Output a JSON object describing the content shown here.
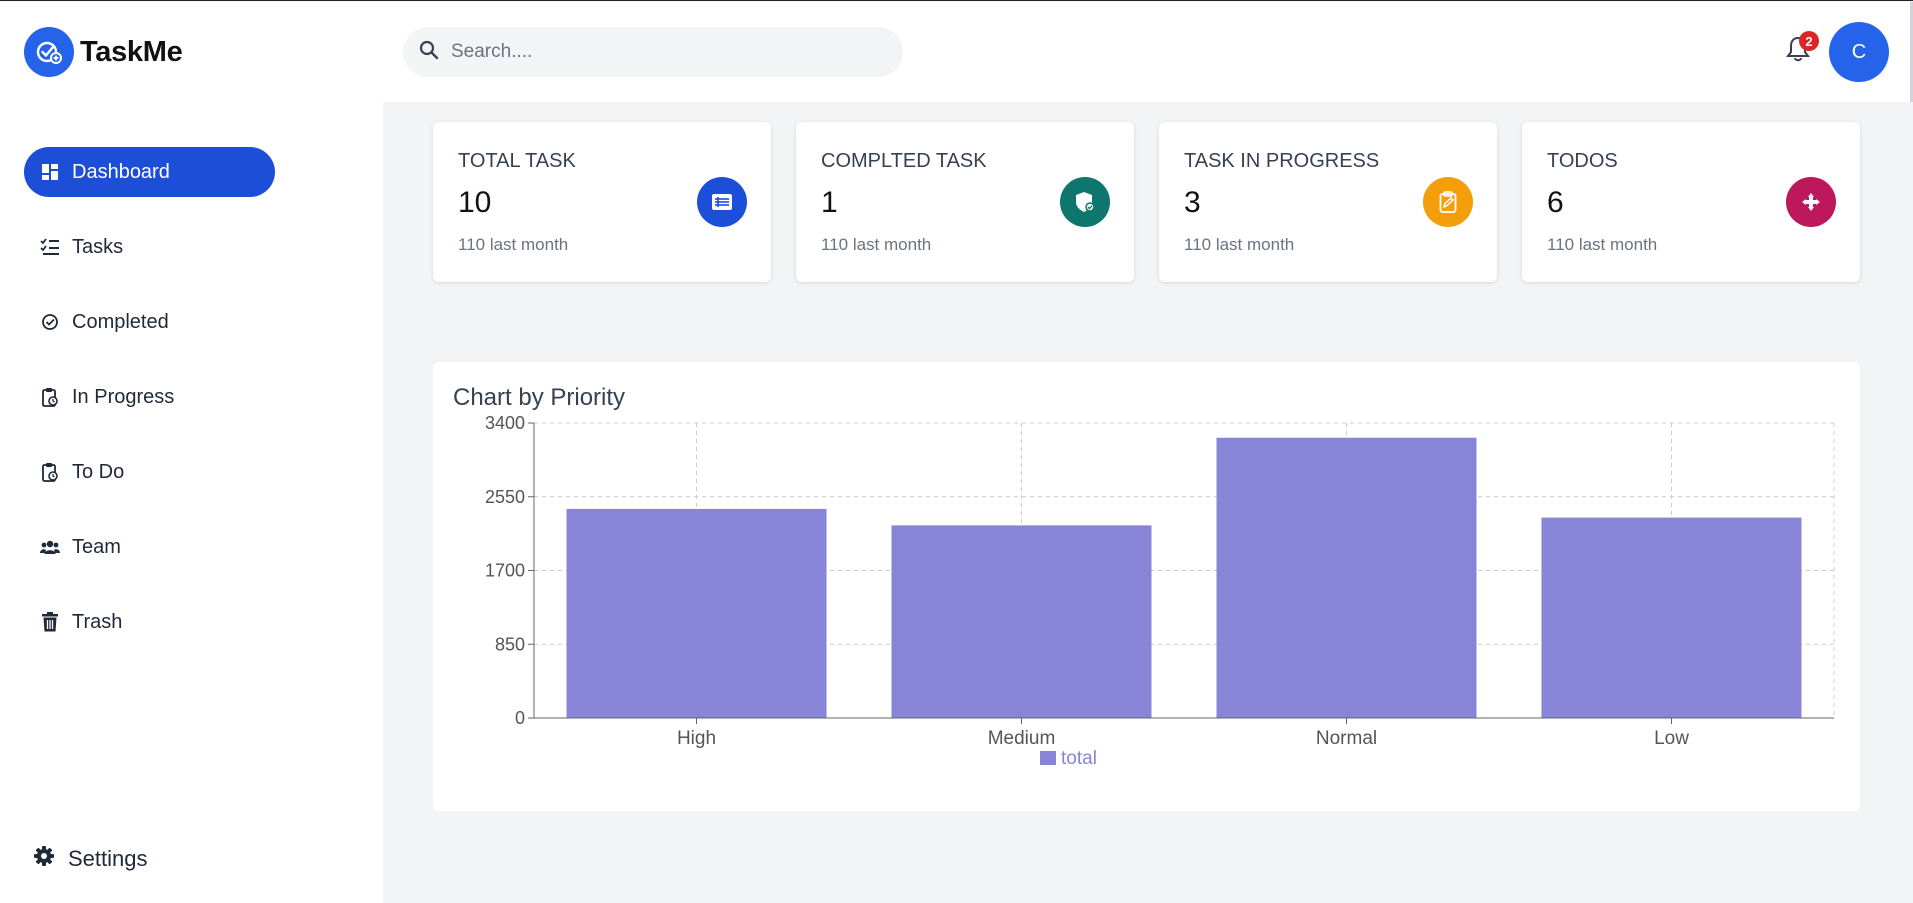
{
  "brand": {
    "name": "TaskMe"
  },
  "sidebar": {
    "items": [
      {
        "label": "Dashboard",
        "icon": "dashboard-icon",
        "active": true
      },
      {
        "label": "Tasks",
        "icon": "checklist-icon",
        "active": false
      },
      {
        "label": "Completed",
        "icon": "check-circle-icon",
        "active": false
      },
      {
        "label": "In Progress",
        "icon": "clipboard-clock-icon",
        "active": false
      },
      {
        "label": "To Do",
        "icon": "clipboard-clock-icon",
        "active": false
      },
      {
        "label": "Team",
        "icon": "users-icon",
        "active": false
      },
      {
        "label": "Trash",
        "icon": "trash-icon",
        "active": false
      }
    ],
    "settings_label": "Settings"
  },
  "header": {
    "search_placeholder": "Search....",
    "notification_count": "2",
    "avatar_initial": "C"
  },
  "stats": [
    {
      "label": "TOTAL TASK",
      "value": "10",
      "sub": "110 last month",
      "color": "#1d4ed8",
      "icon": "list-icon"
    },
    {
      "label": "COMPLTED TASK",
      "value": "1",
      "sub": "110 last month",
      "color": "#0f766e",
      "icon": "shield-check-icon"
    },
    {
      "label": "TASK IN PROGRESS",
      "value": "3",
      "sub": "110 last month",
      "color": "#f59e0b",
      "icon": "clipboard-edit-icon"
    },
    {
      "label": "TODOS",
      "value": "6",
      "sub": "110 last month",
      "color": "#be185d",
      "icon": "arrows-move-icon"
    }
  ],
  "chart_title": "Chart by Priority",
  "chart_data": {
    "type": "bar",
    "title": "Chart by Priority",
    "categories": [
      "High",
      "Medium",
      "Normal",
      "Low"
    ],
    "series": [
      {
        "name": "total",
        "values": [
          2410,
          2220,
          3230,
          2310
        ],
        "color": "#8884d8"
      }
    ],
    "yticks": [
      "0",
      "850",
      "1700",
      "2550",
      "3400"
    ],
    "ylim": [
      0,
      3400
    ],
    "grid": true,
    "legend": "bottom-center"
  }
}
